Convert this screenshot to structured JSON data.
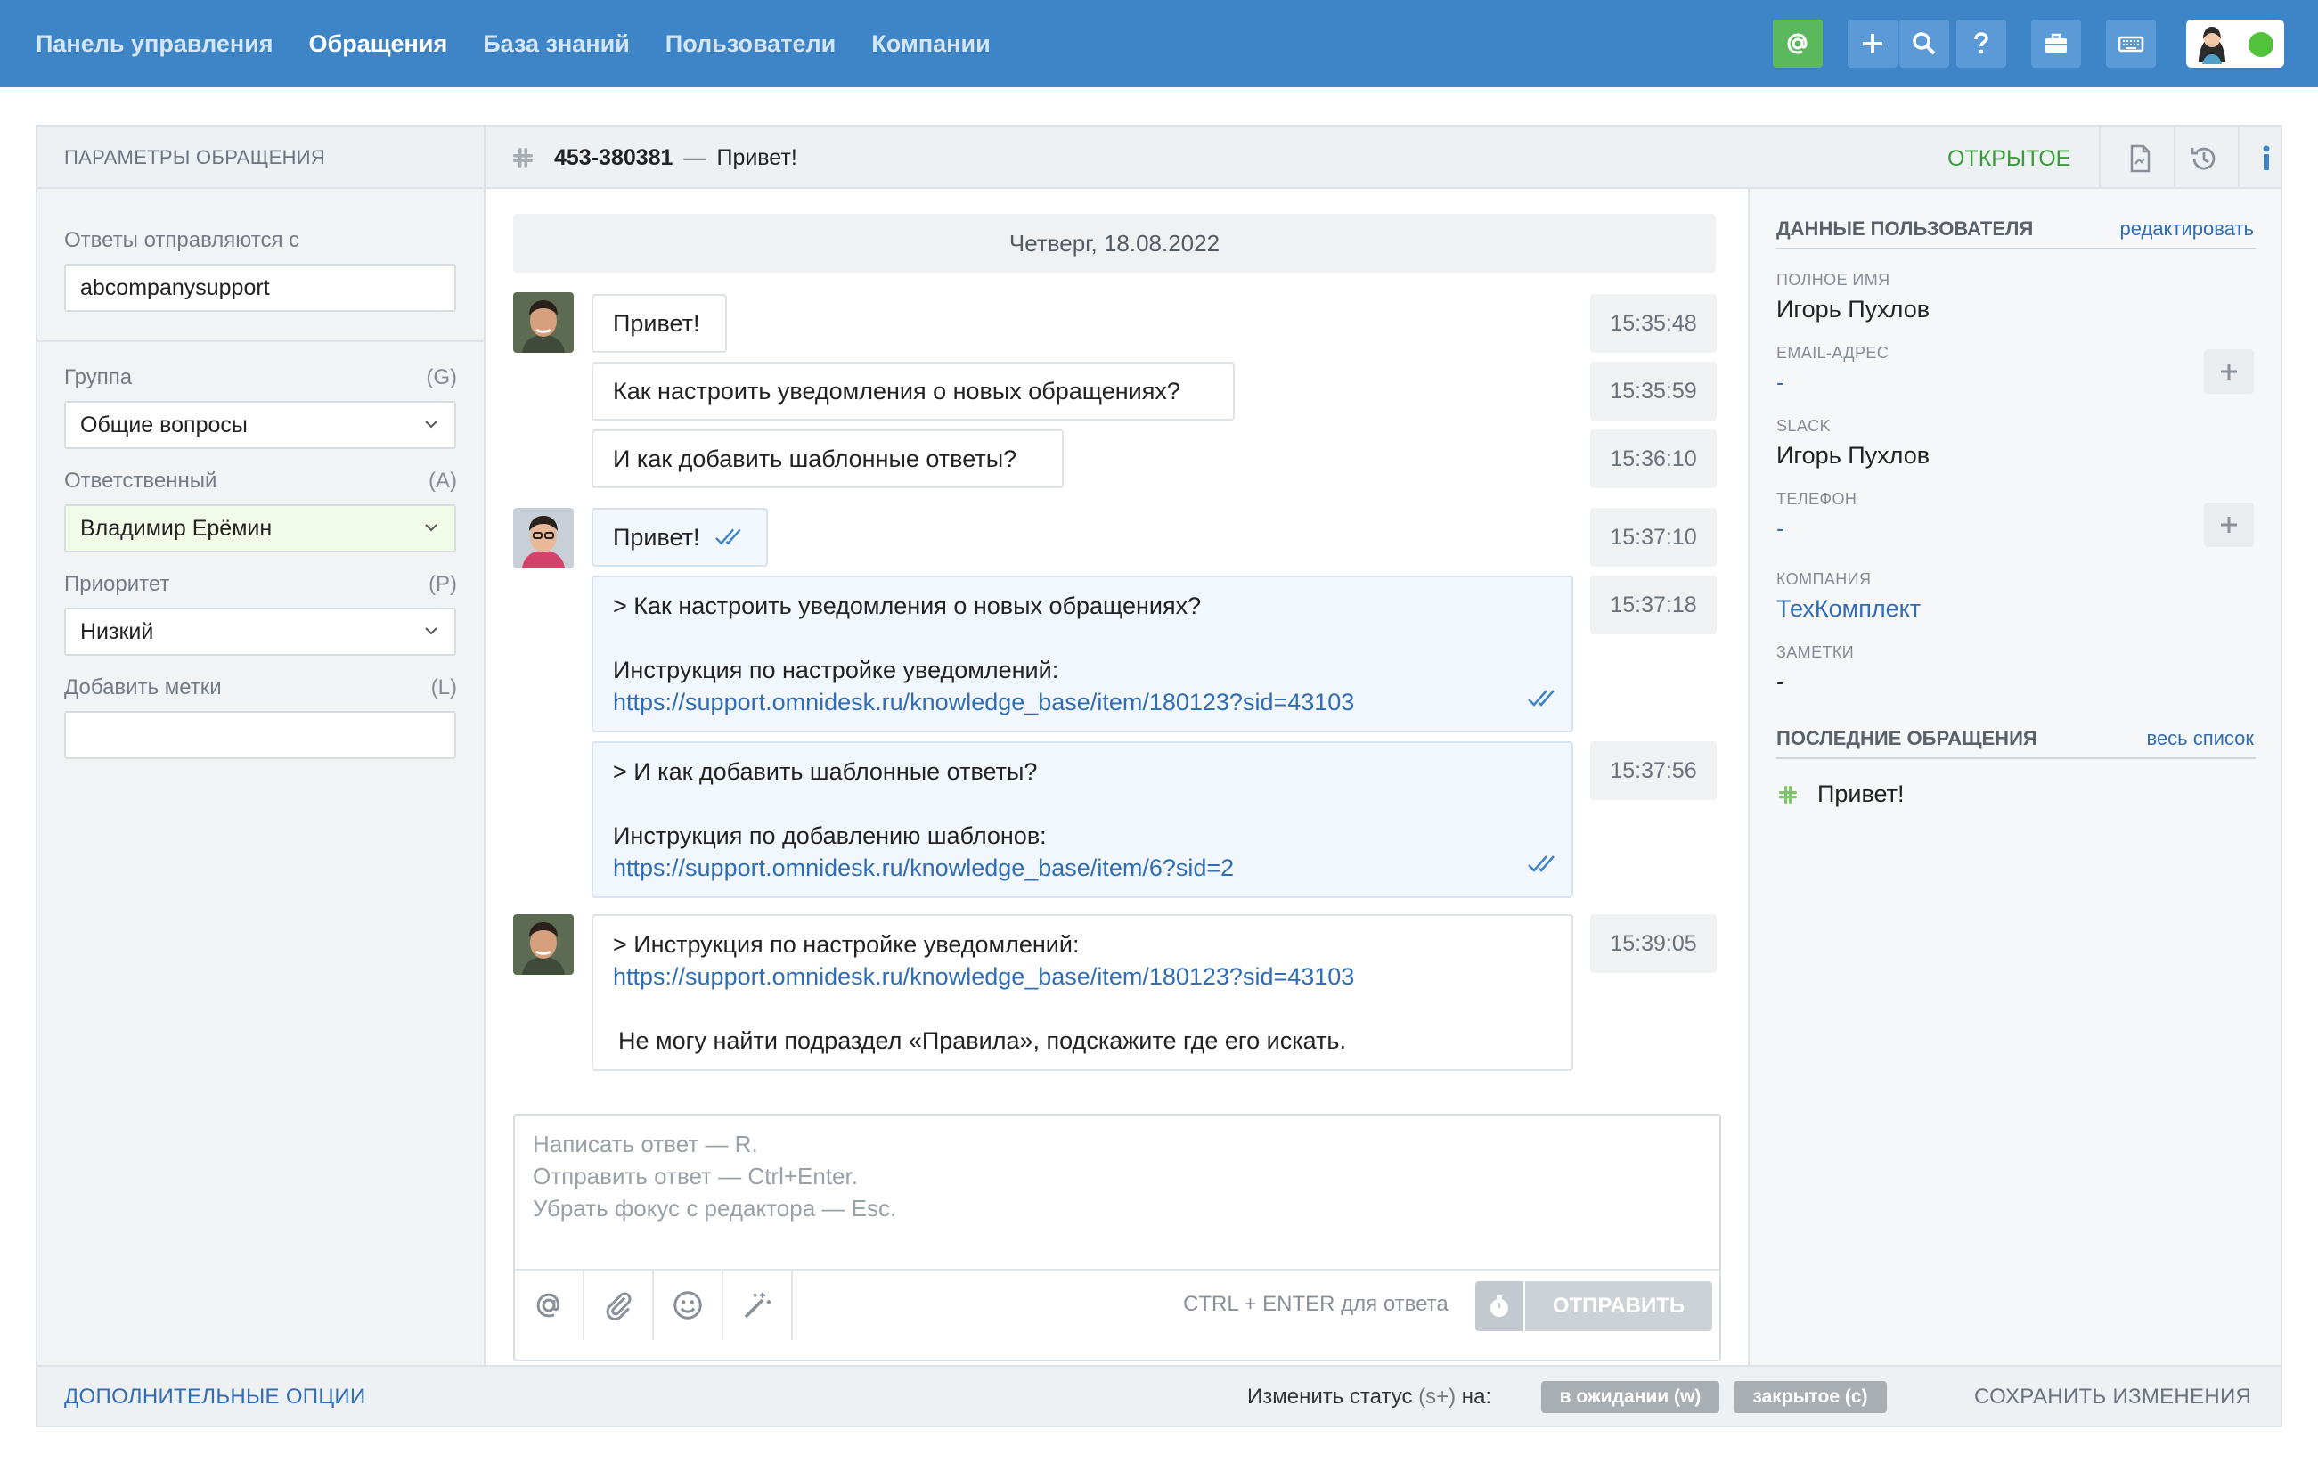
{
  "nav": {
    "items": [
      "Панель управления",
      "Обращения",
      "База знаний",
      "Пользователи",
      "Компании"
    ],
    "active_index": 1
  },
  "icons": {
    "mention": "at-icon",
    "add": "plus-icon",
    "search": "search-icon",
    "help": "question-icon",
    "briefcase": "briefcase-icon",
    "keyboard": "keyboard-icon"
  },
  "left_panel": {
    "title": "ПАРАМЕТРЫ ОБРАЩЕНИЯ",
    "reply_from_label": "Ответы отправляются с",
    "reply_from_value": "abcompanysupport",
    "group_label": "Группа",
    "group_hint": "(G)",
    "group_value": "Общие вопросы",
    "assignee_label": "Ответственный",
    "assignee_hint": "(A)",
    "assignee_value": "Владимир Ерёмин",
    "priority_label": "Приоритет",
    "priority_hint": "(P)",
    "priority_value": "Низкий",
    "tags_label": "Добавить метки",
    "tags_hint": "(L)",
    "tags_value": ""
  },
  "ticket": {
    "number": "453-380381",
    "dash": "—",
    "subject": "Привет!",
    "status": "ОТКРЫТОЕ"
  },
  "chat": {
    "date": "Четверг, 18.08.2022",
    "messages": [
      {
        "text": "Привет!",
        "time": "15:35:48"
      },
      {
        "text": "Как настроить уведомления о новых обращениях?",
        "time": "15:35:59"
      },
      {
        "text": "И как добавить шаблонные ответы?",
        "time": "15:36:10"
      },
      {
        "text": "Привет!",
        "time": "15:37:10"
      },
      {
        "quote": "> Как настроить уведомления о новых обращениях?",
        "text": "Инструкция по настройке уведомлений:",
        "link": "https://support.omnidesk.ru/knowledge_base/item/180123?sid=43103",
        "time": "15:37:18"
      },
      {
        "quote": "> И как добавить шаблонные ответы?",
        "text": "Инструкция по добавлению шаблонов:",
        "link": "https://support.omnidesk.ru/knowledge_base/item/6?sid=2",
        "time": "15:37:56"
      },
      {
        "quote": "> Инструкция по настройке уведомлений:",
        "link": "https://support.omnidesk.ru/knowledge_base/item/180123?sid=43103",
        "text": "Не могу найти подраздел «Правила», подскажите где его искать.",
        "time": "15:39:05"
      }
    ]
  },
  "editor": {
    "placeholder_lines": [
      "Написать ответ — R.",
      "Отправить ответ — Ctrl+Enter.",
      "Убрать фокус с редактора — Esc."
    ],
    "send_hint": "CTRL + ENTER для ответа",
    "send_label": "ОТПРАВИТЬ"
  },
  "user_panel": {
    "title": "ДАННЫЕ ПОЛЬЗОВАТЕЛЯ",
    "edit_link": "редактировать",
    "fullname_label": "ПОЛНОЕ ИМЯ",
    "fullname_value": "Игорь Пухлов",
    "email_label": "EMAIL-АДРЕС",
    "email_value": "-",
    "slack_label": "SLACK",
    "slack_value": "Игорь Пухлов",
    "phone_label": "ТЕЛЕФОН",
    "phone_value": "-",
    "company_label": "КОМПАНИЯ",
    "company_value": "ТехКомплект",
    "notes_label": "ЗАМЕТКИ",
    "notes_value": "-",
    "recent_title": "ПОСЛЕДНИЕ ОБРАЩЕНИЯ",
    "recent_link": "весь список",
    "recent_items": [
      "Привет!"
    ]
  },
  "footer": {
    "more_options": "ДОПОЛНИТЕЛЬНЫЕ ОПЦИИ",
    "change_status_prefix": "Изменить статус ",
    "change_status_shortcut": "(s+)",
    "change_status_suffix": " на:",
    "status_waiting": "в ожидании (w)",
    "status_closed": "закрытое (c)",
    "save": "СОХРАНИТЬ ИЗМЕНЕНИЯ"
  },
  "colors": {
    "topbar": "#3d85c6",
    "open_status": "#3c9a3c",
    "link": "#2f6db5",
    "online": "#52c23d"
  }
}
